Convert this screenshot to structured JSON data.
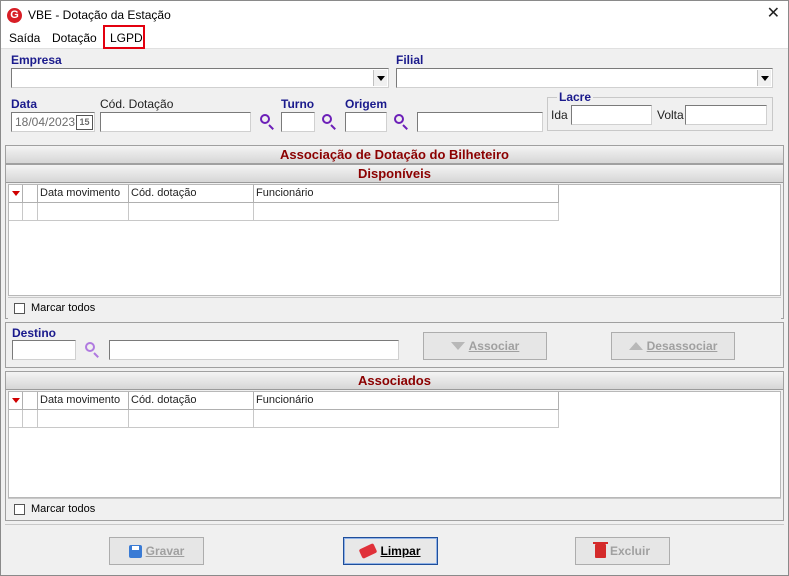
{
  "window": {
    "title": "VBE - Dotação da Estação",
    "logo_letter": "G"
  },
  "menu": {
    "items": [
      "Saída",
      "Dotação",
      "LGPD"
    ]
  },
  "filters": {
    "empresa_label": "Empresa",
    "empresa_value": "",
    "filial_label": "Filial",
    "filial_value": "",
    "data_label": "Data",
    "data_value": "18/04/2023",
    "calendar_glyph": "15",
    "cod_dotacao_label": "Cód. Dotação",
    "turno_label": "Turno",
    "origem_label": "Origem",
    "lacre_label": "Lacre",
    "ida_label": "Ida",
    "volta_label": "Volta"
  },
  "main_section": {
    "title": "Associação de Dotação do Bilheteiro"
  },
  "disponiveis": {
    "title": "Disponíveis",
    "columns": [
      "Data movimento",
      "Cód. dotação",
      "Funcionário"
    ],
    "marcar_todos": "Marcar todos"
  },
  "destino": {
    "label": "Destino",
    "associar": "Associar",
    "desassociar": "Desassociar"
  },
  "associados": {
    "title": "Associados",
    "columns": [
      "Data movimento",
      "Cód. dotação",
      "Funcionário"
    ],
    "marcar_todos": "Marcar todos"
  },
  "actions": {
    "gravar": "Gravar",
    "limpar": "Limpar",
    "excluir": "Excluir"
  },
  "colors": {
    "highlight": "#e3000f",
    "section_title": "#8b0000",
    "label_blue": "#1a1a8c",
    "search_icon": "#6c1fb8"
  }
}
